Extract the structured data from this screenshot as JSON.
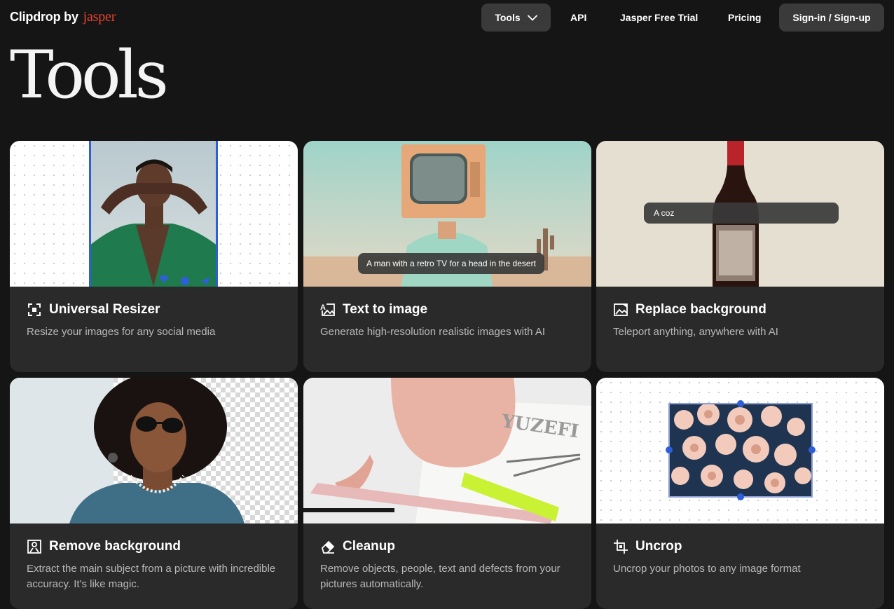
{
  "header": {
    "logo_text": "Clipdrop by",
    "brand": "jasper",
    "brand_color": "#e8412c",
    "nav": {
      "tools": "Tools",
      "api": "API",
      "trial": "Jasper Free Trial",
      "pricing": "Pricing",
      "signin": "Sign-in / Sign-up"
    }
  },
  "page": {
    "title": "Tools"
  },
  "cards": [
    {
      "title": "Universal Resizer",
      "desc": "Resize your images for any social media",
      "icon": "resize-icon"
    },
    {
      "title": "Text to image",
      "desc": "Generate high-resolution realistic images with AI",
      "icon": "text-to-image-icon",
      "prompt": "A man with a retro TV for a head in the desert"
    },
    {
      "title": "Replace background",
      "desc": "Teleport anything, anywhere with AI",
      "icon": "replace-background-icon",
      "prompt": "A coz"
    },
    {
      "title": "Remove background",
      "desc": "Extract the main subject from a picture with incredible accuracy. It's like magic.",
      "icon": "remove-background-icon"
    },
    {
      "title": "Cleanup",
      "desc": "Remove objects, people, text and defects from your pictures automatically.",
      "icon": "eraser-icon",
      "image_text": "YUZEFI"
    },
    {
      "title": "Uncrop",
      "desc": "Uncrop your photos to any image format",
      "icon": "crop-icon"
    }
  ],
  "colors": {
    "background": "#151515",
    "card": "#2a2a2a",
    "accent_blue": "#2f5fd8",
    "button": "#3a3a3a"
  }
}
